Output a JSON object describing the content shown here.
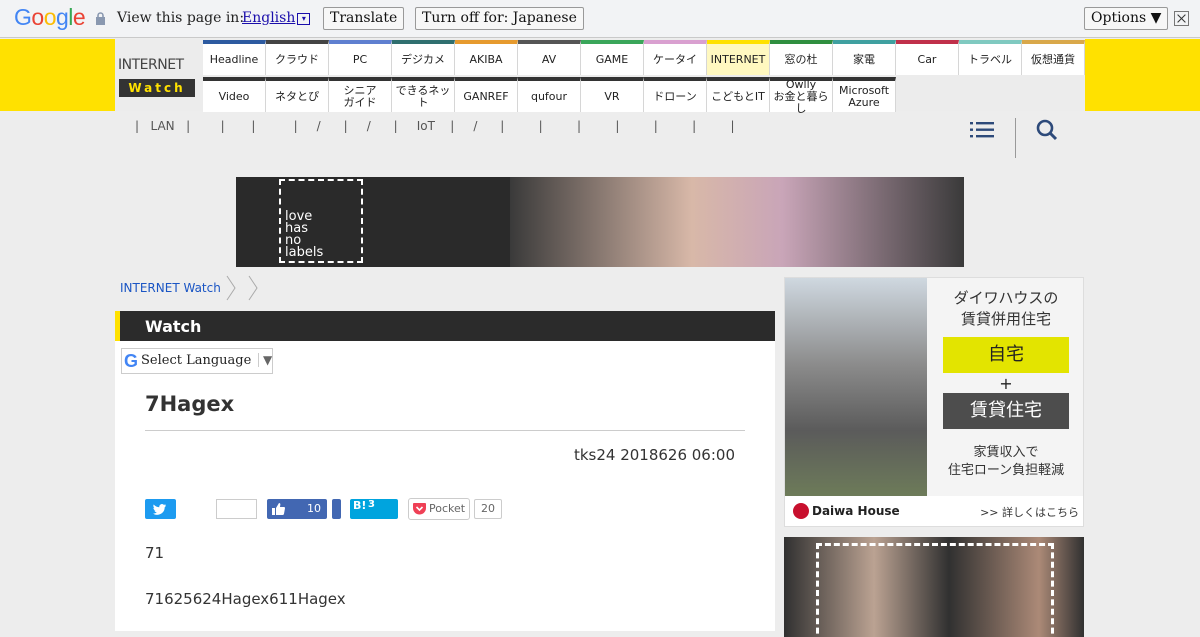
{
  "translate_bar": {
    "logo": "Google",
    "prompt": "View this page in:",
    "language": "English",
    "caret": "▾",
    "translate_label": "Translate",
    "turn_off_label": "Turn off for: Japanese",
    "options_label": "Options ▼"
  },
  "header": {
    "logo_top": "INTERNET",
    "logo_bottom": "Watch",
    "nav_row1": [
      {
        "label": "Headline",
        "color": "#2d5aa0"
      },
      {
        "label": "クラウド",
        "color": "#444444"
      },
      {
        "label": "PC",
        "color": "#5f7fd0"
      },
      {
        "label": "デジカメ",
        "color": "#2f6f6f"
      },
      {
        "label": "AKIBA",
        "color": "#e69a2e"
      },
      {
        "label": "AV",
        "color": "#555555"
      },
      {
        "label": "GAME",
        "color": "#3aa65a"
      },
      {
        "label": "ケータイ",
        "color": "#d9a0d0"
      },
      {
        "label": "INTERNET",
        "color": "#ffe100",
        "active": true
      },
      {
        "label": "窓の杜",
        "color": "#2f8f3f"
      },
      {
        "label": "家電",
        "color": "#3fa0a0"
      },
      {
        "label": "Car",
        "color": "#c0304a"
      },
      {
        "label": "トラベル",
        "color": "#7fc9c0"
      },
      {
        "label": "仮想通貨",
        "color": "#d9a84a"
      }
    ],
    "nav_row2": [
      {
        "label": "Video"
      },
      {
        "label": "ネタとぴ"
      },
      {
        "label": "シニア\nガイド"
      },
      {
        "label": "できるネット"
      },
      {
        "label": "GANREF"
      },
      {
        "label": "qufour"
      },
      {
        "label": "VR"
      },
      {
        "label": "ドローン"
      },
      {
        "label": "こどもとIT"
      },
      {
        "label": "Owlly\nお金と暮らし"
      },
      {
        "label": "Microsoft\nAzure"
      }
    ],
    "subnav": "|   LAN   |        |       |          |     /      |     /      |     IoT    |     /      |         |         |         |         |         |         |"
  },
  "banner": {
    "text": "love\nhas\nno\nlabels"
  },
  "breadcrumb": {
    "home": "INTERNET Watch"
  },
  "main": {
    "section_title": "Watch",
    "select_language_g": "G",
    "select_language": "Select Language",
    "select_arrow": "▼",
    "article_title": "7Hagex",
    "meta": "tks24   2018626 06:00",
    "share": {
      "fb_count": "10",
      "hatena_label": "B!",
      "hatena_count": "3",
      "pocket_label": "Pocket",
      "pocket_count": "20"
    },
    "para1": "71",
    "para2": "71625624Hagex611Hagex"
  },
  "ad": {
    "heading": "ダイワハウスの\n賃貸併用住宅",
    "box1": "自宅",
    "plus": "+",
    "box2": "賃貸住宅",
    "sub": "家賃収入で\n住宅ローン負担軽減",
    "brand": "Daiwa House",
    "more": ">> 詳しくはこちら"
  }
}
